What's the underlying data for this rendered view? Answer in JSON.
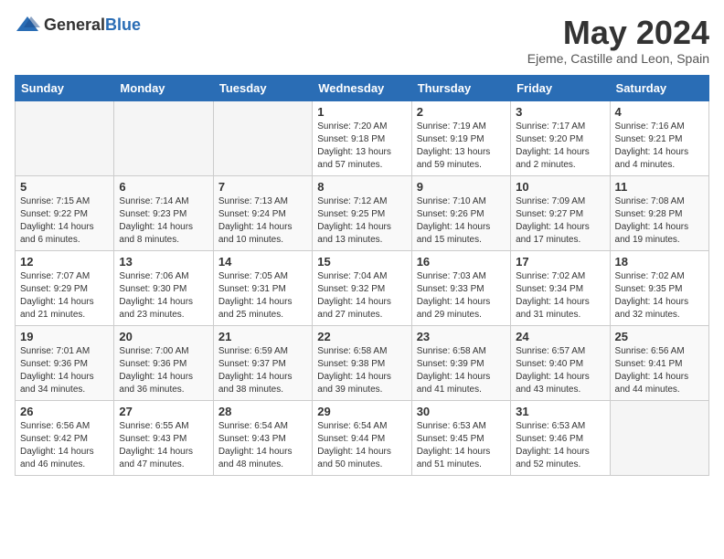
{
  "logo": {
    "general": "General",
    "blue": "Blue"
  },
  "header": {
    "title": "May 2024",
    "subtitle": "Ejeme, Castille and Leon, Spain"
  },
  "weekdays": [
    "Sunday",
    "Monday",
    "Tuesday",
    "Wednesday",
    "Thursday",
    "Friday",
    "Saturday"
  ],
  "weeks": [
    [
      {
        "day": "",
        "sunrise": "",
        "sunset": "",
        "daylight": ""
      },
      {
        "day": "",
        "sunrise": "",
        "sunset": "",
        "daylight": ""
      },
      {
        "day": "",
        "sunrise": "",
        "sunset": "",
        "daylight": ""
      },
      {
        "day": "1",
        "sunrise": "Sunrise: 7:20 AM",
        "sunset": "Sunset: 9:18 PM",
        "daylight": "Daylight: 13 hours and 57 minutes."
      },
      {
        "day": "2",
        "sunrise": "Sunrise: 7:19 AM",
        "sunset": "Sunset: 9:19 PM",
        "daylight": "Daylight: 13 hours and 59 minutes."
      },
      {
        "day": "3",
        "sunrise": "Sunrise: 7:17 AM",
        "sunset": "Sunset: 9:20 PM",
        "daylight": "Daylight: 14 hours and 2 minutes."
      },
      {
        "day": "4",
        "sunrise": "Sunrise: 7:16 AM",
        "sunset": "Sunset: 9:21 PM",
        "daylight": "Daylight: 14 hours and 4 minutes."
      }
    ],
    [
      {
        "day": "5",
        "sunrise": "Sunrise: 7:15 AM",
        "sunset": "Sunset: 9:22 PM",
        "daylight": "Daylight: 14 hours and 6 minutes."
      },
      {
        "day": "6",
        "sunrise": "Sunrise: 7:14 AM",
        "sunset": "Sunset: 9:23 PM",
        "daylight": "Daylight: 14 hours and 8 minutes."
      },
      {
        "day": "7",
        "sunrise": "Sunrise: 7:13 AM",
        "sunset": "Sunset: 9:24 PM",
        "daylight": "Daylight: 14 hours and 10 minutes."
      },
      {
        "day": "8",
        "sunrise": "Sunrise: 7:12 AM",
        "sunset": "Sunset: 9:25 PM",
        "daylight": "Daylight: 14 hours and 13 minutes."
      },
      {
        "day": "9",
        "sunrise": "Sunrise: 7:10 AM",
        "sunset": "Sunset: 9:26 PM",
        "daylight": "Daylight: 14 hours and 15 minutes."
      },
      {
        "day": "10",
        "sunrise": "Sunrise: 7:09 AM",
        "sunset": "Sunset: 9:27 PM",
        "daylight": "Daylight: 14 hours and 17 minutes."
      },
      {
        "day": "11",
        "sunrise": "Sunrise: 7:08 AM",
        "sunset": "Sunset: 9:28 PM",
        "daylight": "Daylight: 14 hours and 19 minutes."
      }
    ],
    [
      {
        "day": "12",
        "sunrise": "Sunrise: 7:07 AM",
        "sunset": "Sunset: 9:29 PM",
        "daylight": "Daylight: 14 hours and 21 minutes."
      },
      {
        "day": "13",
        "sunrise": "Sunrise: 7:06 AM",
        "sunset": "Sunset: 9:30 PM",
        "daylight": "Daylight: 14 hours and 23 minutes."
      },
      {
        "day": "14",
        "sunrise": "Sunrise: 7:05 AM",
        "sunset": "Sunset: 9:31 PM",
        "daylight": "Daylight: 14 hours and 25 minutes."
      },
      {
        "day": "15",
        "sunrise": "Sunrise: 7:04 AM",
        "sunset": "Sunset: 9:32 PM",
        "daylight": "Daylight: 14 hours and 27 minutes."
      },
      {
        "day": "16",
        "sunrise": "Sunrise: 7:03 AM",
        "sunset": "Sunset: 9:33 PM",
        "daylight": "Daylight: 14 hours and 29 minutes."
      },
      {
        "day": "17",
        "sunrise": "Sunrise: 7:02 AM",
        "sunset": "Sunset: 9:34 PM",
        "daylight": "Daylight: 14 hours and 31 minutes."
      },
      {
        "day": "18",
        "sunrise": "Sunrise: 7:02 AM",
        "sunset": "Sunset: 9:35 PM",
        "daylight": "Daylight: 14 hours and 32 minutes."
      }
    ],
    [
      {
        "day": "19",
        "sunrise": "Sunrise: 7:01 AM",
        "sunset": "Sunset: 9:36 PM",
        "daylight": "Daylight: 14 hours and 34 minutes."
      },
      {
        "day": "20",
        "sunrise": "Sunrise: 7:00 AM",
        "sunset": "Sunset: 9:36 PM",
        "daylight": "Daylight: 14 hours and 36 minutes."
      },
      {
        "day": "21",
        "sunrise": "Sunrise: 6:59 AM",
        "sunset": "Sunset: 9:37 PM",
        "daylight": "Daylight: 14 hours and 38 minutes."
      },
      {
        "day": "22",
        "sunrise": "Sunrise: 6:58 AM",
        "sunset": "Sunset: 9:38 PM",
        "daylight": "Daylight: 14 hours and 39 minutes."
      },
      {
        "day": "23",
        "sunrise": "Sunrise: 6:58 AM",
        "sunset": "Sunset: 9:39 PM",
        "daylight": "Daylight: 14 hours and 41 minutes."
      },
      {
        "day": "24",
        "sunrise": "Sunrise: 6:57 AM",
        "sunset": "Sunset: 9:40 PM",
        "daylight": "Daylight: 14 hours and 43 minutes."
      },
      {
        "day": "25",
        "sunrise": "Sunrise: 6:56 AM",
        "sunset": "Sunset: 9:41 PM",
        "daylight": "Daylight: 14 hours and 44 minutes."
      }
    ],
    [
      {
        "day": "26",
        "sunrise": "Sunrise: 6:56 AM",
        "sunset": "Sunset: 9:42 PM",
        "daylight": "Daylight: 14 hours and 46 minutes."
      },
      {
        "day": "27",
        "sunrise": "Sunrise: 6:55 AM",
        "sunset": "Sunset: 9:43 PM",
        "daylight": "Daylight: 14 hours and 47 minutes."
      },
      {
        "day": "28",
        "sunrise": "Sunrise: 6:54 AM",
        "sunset": "Sunset: 9:43 PM",
        "daylight": "Daylight: 14 hours and 48 minutes."
      },
      {
        "day": "29",
        "sunrise": "Sunrise: 6:54 AM",
        "sunset": "Sunset: 9:44 PM",
        "daylight": "Daylight: 14 hours and 50 minutes."
      },
      {
        "day": "30",
        "sunrise": "Sunrise: 6:53 AM",
        "sunset": "Sunset: 9:45 PM",
        "daylight": "Daylight: 14 hours and 51 minutes."
      },
      {
        "day": "31",
        "sunrise": "Sunrise: 6:53 AM",
        "sunset": "Sunset: 9:46 PM",
        "daylight": "Daylight: 14 hours and 52 minutes."
      },
      {
        "day": "",
        "sunrise": "",
        "sunset": "",
        "daylight": ""
      }
    ]
  ]
}
